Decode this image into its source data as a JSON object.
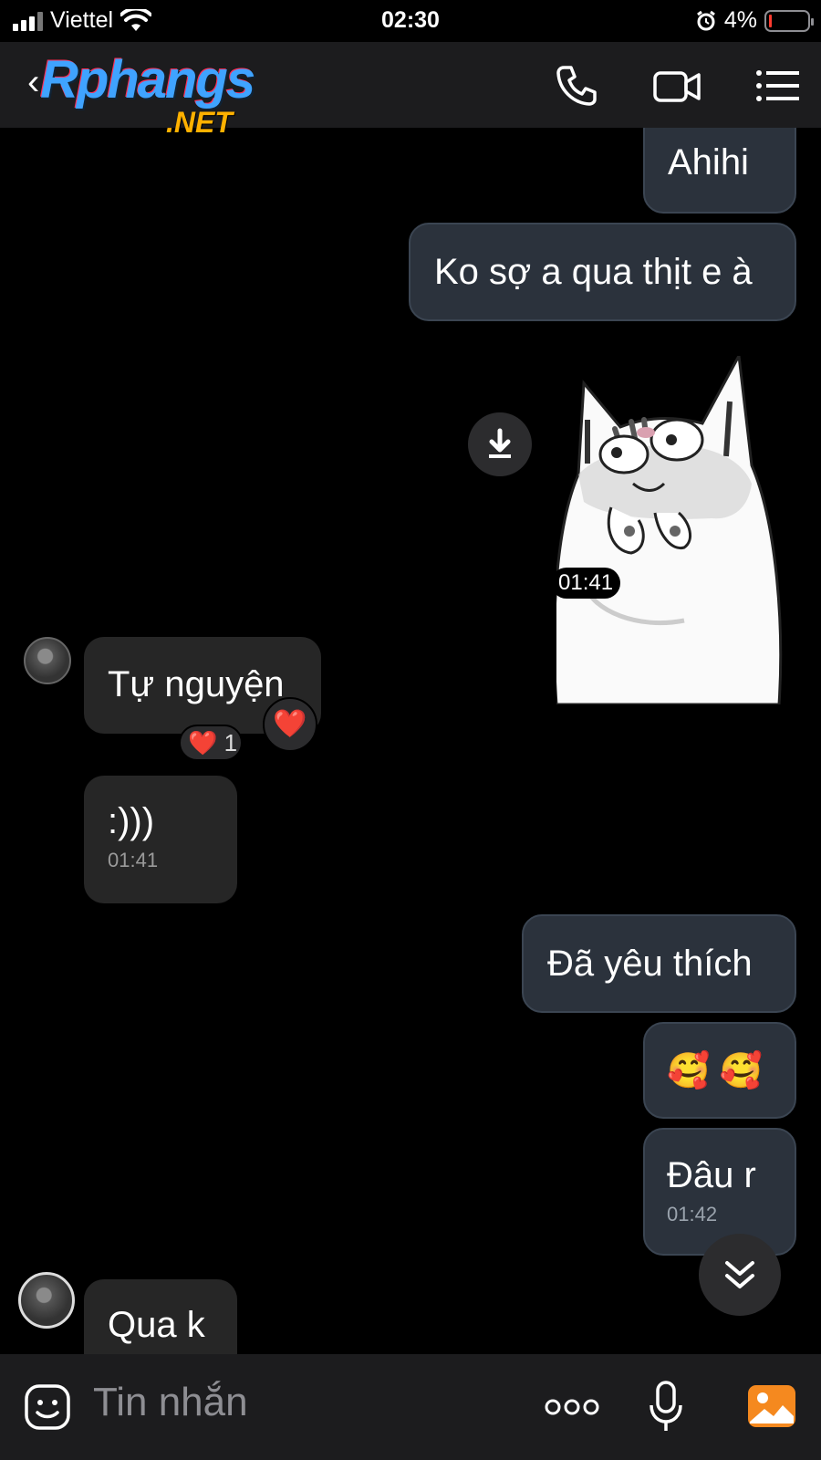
{
  "status_bar": {
    "carrier": "Viettel",
    "time": "02:30",
    "battery": "4%",
    "battery_level": 0.04
  },
  "header": {
    "logo_main": "Rphangs",
    "logo_sub": ".NET",
    "icons": [
      "back-icon",
      "phone-icon",
      "video-call-icon",
      "menu-list-icon"
    ]
  },
  "messages": {
    "m1": {
      "text": "Ahihi"
    },
    "m2": {
      "text": "Ko sợ a qua thịt e à"
    },
    "sticker": {
      "time": "01:41",
      "icon": "cat-sticker"
    },
    "m3": {
      "text": "Tự nguyện",
      "reaction_emoji": "❤️",
      "reaction_count": "1",
      "react_button": "❤️"
    },
    "m4": {
      "text": ":)))",
      "time": "01:41"
    },
    "m5": {
      "text": "Đã yêu thích"
    },
    "m6": {
      "text": "🥰 🥰"
    },
    "m7": {
      "text": "Đâu r",
      "time": "01:42"
    },
    "m8": {
      "text": "Qua k"
    }
  },
  "input": {
    "placeholder": "Tin nhắn",
    "icons": [
      "sticker-icon",
      "more-dots-icon",
      "microphone-icon",
      "gallery-icon"
    ]
  },
  "colors": {
    "background": "#000000",
    "outgoing_bubble": "#2b323c",
    "incoming_bubble": "#262626",
    "gallery_accent": "#f5891f"
  }
}
